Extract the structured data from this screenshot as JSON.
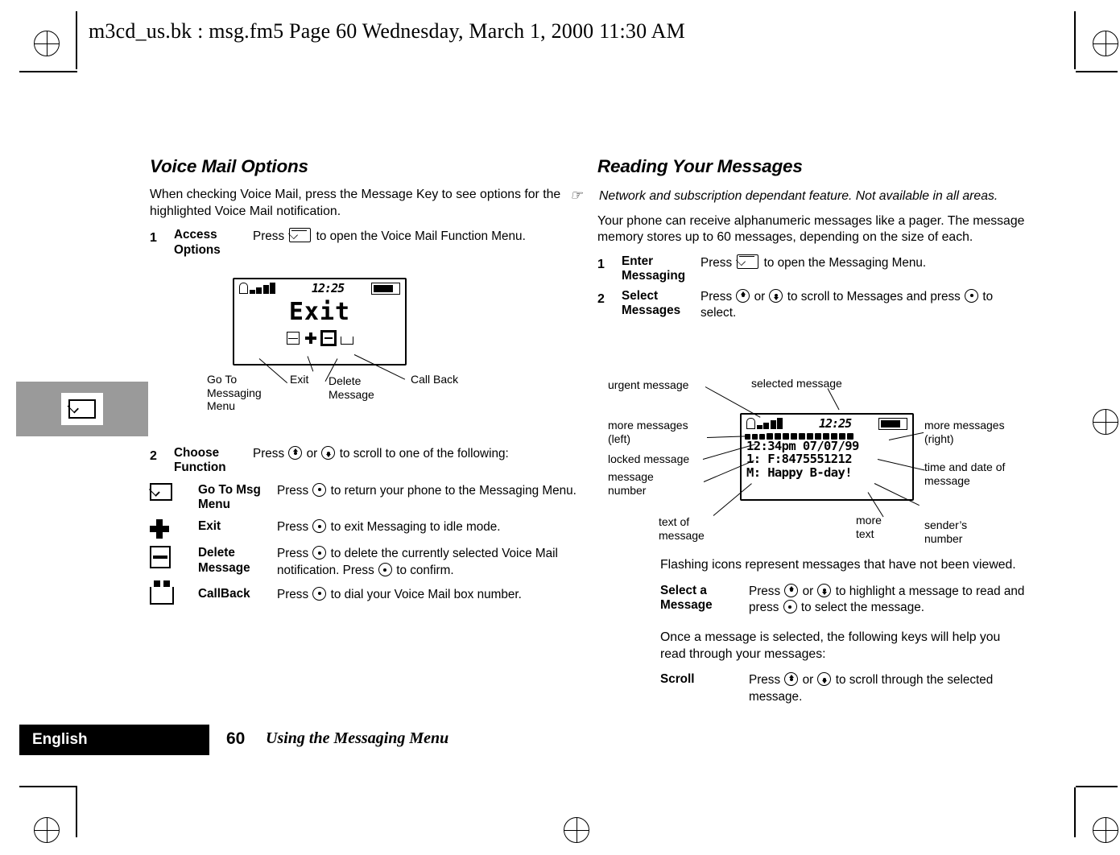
{
  "header": {
    "text": "m3cd_us.bk : msg.fm5  Page 60  Wednesday, March 1, 2000  11:30 AM"
  },
  "left": {
    "heading": "Voice Mail Options",
    "intro": "When checking Voice Mail, press the Message Key to see options for the highlighted Voice Mail notification.",
    "step1": {
      "num": "1",
      "title": "Access Options",
      "text_a": "Press",
      "text_b": "to open the Voice Mail Function Menu."
    },
    "lcd": {
      "clock": "12:25",
      "big_text": "Exit"
    },
    "callouts": {
      "goto": "Go To Messaging Menu",
      "exit": "Exit",
      "delete": "Delete Message",
      "callback": "Call Back"
    },
    "step2": {
      "num": "2",
      "title": "Choose Function",
      "text_a": "Press",
      "text_b": "or",
      "text_c": "to scroll to one of the following:"
    },
    "rows": [
      {
        "icon": "envelope-icon",
        "title": "Go To Msg Menu",
        "text_a": "Press",
        "text_b": "to return your phone to the Messaging Menu."
      },
      {
        "icon": "exit-cross-icon",
        "title": "Exit",
        "text_a": "Press",
        "text_b": "to exit Messaging to idle mode."
      },
      {
        "icon": "delete-icon",
        "title": "Delete Message",
        "text_a": "Press",
        "text_b": "to delete the currently selected Voice Mail notification. Press",
        "text_c": "to confirm."
      },
      {
        "icon": "callback-icon",
        "title": "CallBack",
        "text_a": "Press",
        "text_b": "to dial your Voice Mail box number."
      }
    ]
  },
  "right": {
    "heading": "Reading Your Messages",
    "note": "Network and subscription dependant feature. Not available in all areas.",
    "intro": "Your phone can receive alphanumeric messages like a pager. The message memory stores up to 60 messages, depending on the size of each.",
    "step1": {
      "num": "1",
      "title": "Enter Messaging",
      "text_a": "Press",
      "text_b": "to open the Messaging Menu."
    },
    "step2": {
      "num": "2",
      "title": "Select Messages",
      "text_a": "Press",
      "text_b": "or",
      "text_c": "to scroll to Messages and press",
      "text_d": "to select."
    },
    "lcd": {
      "clock": "12:25",
      "line1": "12:34pm 07/07/99",
      "line2": "1: F:8475551212",
      "line3": "M: Happy B-day!"
    },
    "callouts": {
      "urgent": "urgent message",
      "selected": "selected message",
      "more_left": "more messages (left)",
      "more_right": "more messages (right)",
      "locked": "locked message",
      "msg_number": "message number",
      "time_date": "time and date of message",
      "text_of_msg": "text of message",
      "more_text": "more text",
      "sender": "sender’s number"
    },
    "flashing": "Flashing icons represent messages that have not been viewed.",
    "select_row": {
      "title": "Select a Message",
      "text_a": "Press",
      "text_b": "or",
      "text_c": "to highlight a message to read and press",
      "text_d": "to select the message."
    },
    "once": "Once a message is selected, the following keys will help you read through your messages:",
    "scroll_row": {
      "title": "Scroll",
      "text_a": "Press",
      "text_b": "or",
      "text_c": "to scroll through the selected message."
    }
  },
  "footer": {
    "language": "English",
    "page": "60",
    "title": "Using the Messaging Menu"
  }
}
